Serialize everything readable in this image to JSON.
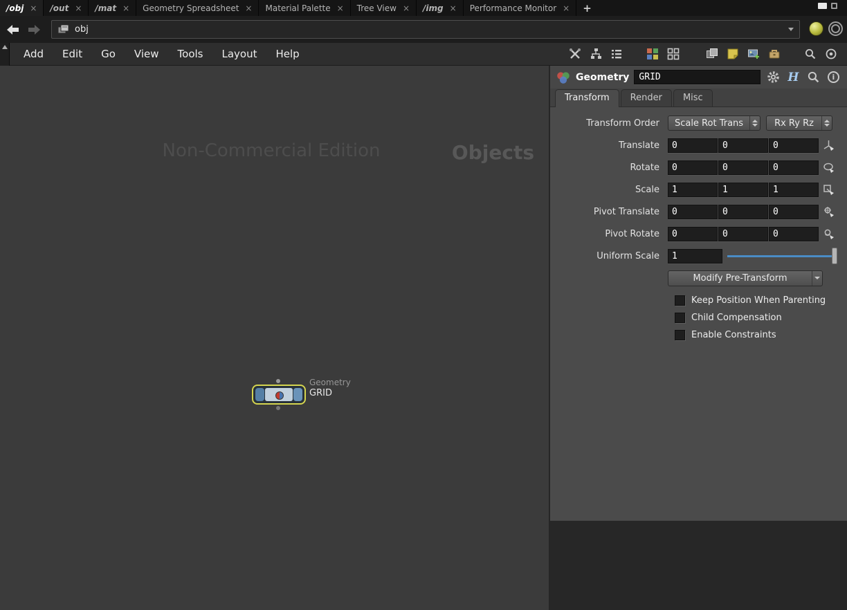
{
  "tab_bar": {
    "tabs": [
      {
        "label": "/obj",
        "active": true
      },
      {
        "label": "/out",
        "active": false
      },
      {
        "label": "/mat",
        "active": false
      },
      {
        "label": "Geometry Spreadsheet",
        "active": false
      },
      {
        "label": "Material Palette",
        "active": false
      },
      {
        "label": "Tree View",
        "active": false
      },
      {
        "label": "/img",
        "active": false
      },
      {
        "label": "Performance Monitor",
        "active": false
      }
    ],
    "close_glyph": "×",
    "new_tab_label": "+"
  },
  "path_bar": {
    "path": "obj"
  },
  "menu_bar": {
    "items": [
      "Add",
      "Edit",
      "Go",
      "View",
      "Tools",
      "Layout",
      "Help"
    ]
  },
  "network": {
    "watermark": "Non-Commercial Edition",
    "context_label": "Objects",
    "node": {
      "type_label": "Geometry",
      "name": "GRID"
    }
  },
  "panel": {
    "header": {
      "type": "Geometry",
      "name_value": "GRID"
    },
    "tabs": [
      {
        "label": "Transform",
        "active": true
      },
      {
        "label": "Render",
        "active": false
      },
      {
        "label": "Misc",
        "active": false
      }
    ],
    "params": {
      "transform_order": {
        "label": "Transform Order",
        "order": "Scale Rot Trans",
        "rotate_order": "Rx Ry Rz"
      },
      "translate": {
        "label": "Translate",
        "values": [
          "0",
          "0",
          "0"
        ]
      },
      "rotate": {
        "label": "Rotate",
        "values": [
          "0",
          "0",
          "0"
        ]
      },
      "scale": {
        "label": "Scale",
        "values": [
          "1",
          "1",
          "1"
        ]
      },
      "pivot_translate": {
        "label": "Pivot Translate",
        "values": [
          "0",
          "0",
          "0"
        ]
      },
      "pivot_rotate": {
        "label": "Pivot Rotate",
        "values": [
          "0",
          "0",
          "0"
        ]
      },
      "uniform_scale": {
        "label": "Uniform Scale",
        "value": "1"
      },
      "pre_transform": {
        "label": "Modify Pre-Transform"
      },
      "checkboxes": [
        {
          "label": "Keep Position When Parenting",
          "checked": false
        },
        {
          "label": "Child Compensation",
          "checked": false
        },
        {
          "label": "Enable Constraints",
          "checked": false
        }
      ]
    }
  },
  "icons": {
    "houdini_badge": "H",
    "info_glyph": "i",
    "help_glyph": "?"
  },
  "colors": {
    "accent_blue_slider": "#4a8cc6",
    "node_select_yellow": "#d5d54f",
    "node_flag_blue": "#557fa5",
    "network_bg": "#3b3b3b",
    "panel_bg": "#4b4b4b"
  }
}
